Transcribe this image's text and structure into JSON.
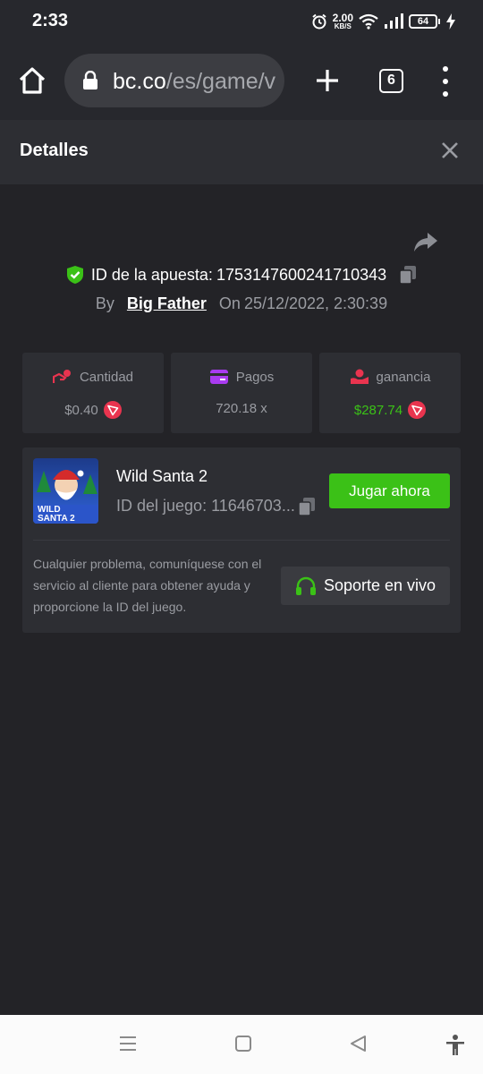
{
  "status_bar": {
    "time": "2:33",
    "net_speed_value": "2.00",
    "net_speed_unit": "KB/S",
    "battery": "64"
  },
  "browser": {
    "url_host": "bc.co",
    "url_path": "/es/game/v",
    "tab_count": "6"
  },
  "modal": {
    "title": "Detalles"
  },
  "bet": {
    "id_label": "ID de la apuesta:",
    "id_value": "1753147600241710343",
    "by_label": "By",
    "player": "Big Father",
    "on_label": "On",
    "datetime": "25/12/2022, 2:30:39"
  },
  "stats": {
    "amount_label": "Cantidad",
    "amount_value": "$0.40",
    "payout_label": "Pagos",
    "payout_value": "720.18 x",
    "profit_label": "ganancia",
    "profit_value": "$287.74"
  },
  "game": {
    "thumb_line1": "WILD",
    "thumb_line2": "SANTA 2",
    "name": "Wild Santa 2",
    "id_text": "ID del juego: 11646703...",
    "play_label": "Jugar ahora",
    "help_text": "Cualquier problema, comuníquese con el servicio al cliente para obtener ayuda y proporcione la ID del juego.",
    "support_label": "Soporte en vivo"
  },
  "colors": {
    "accent_green": "#3bc117",
    "background": "#232327",
    "panel": "#2d2e33",
    "trx_red": "#e9344f"
  }
}
